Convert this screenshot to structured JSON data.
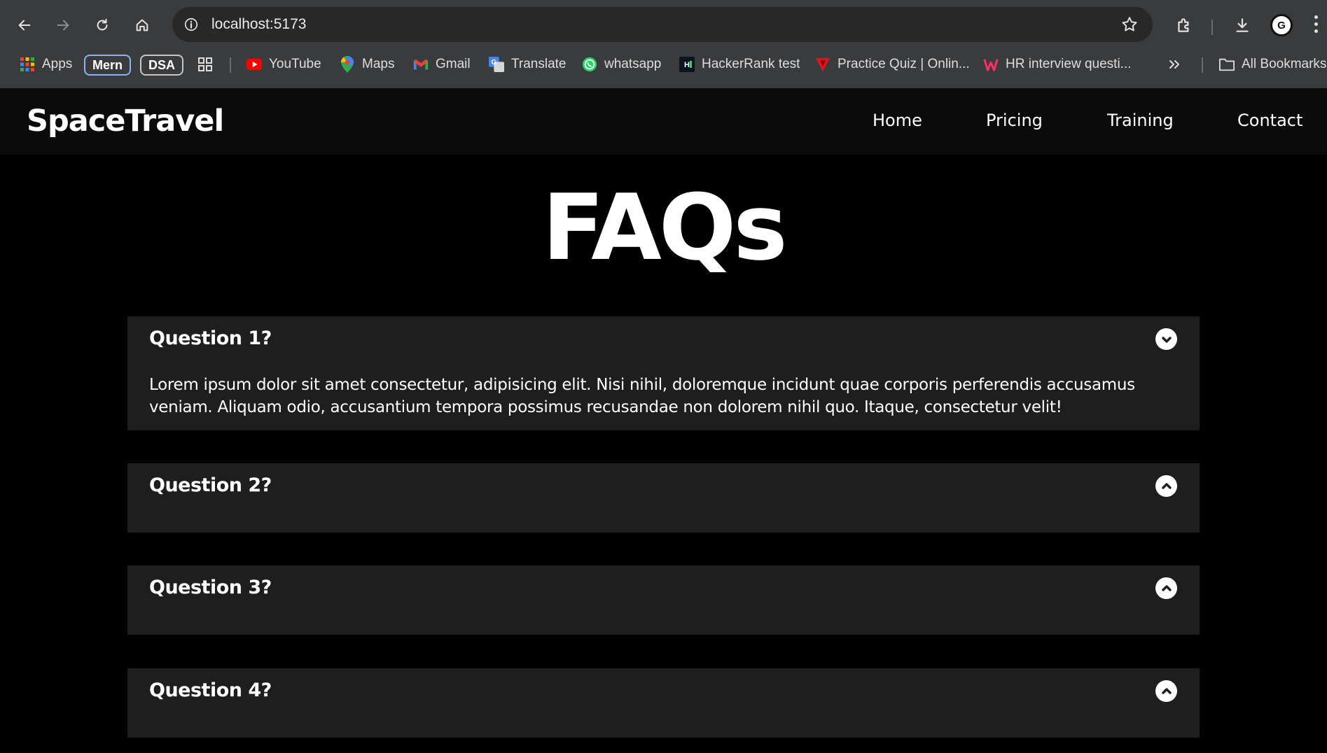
{
  "browser": {
    "url": "localhost:5173",
    "bookmarks": {
      "apps": "Apps",
      "mern": "Mern",
      "dsa": "DSA",
      "youtube": "YouTube",
      "maps": "Maps",
      "gmail": "Gmail",
      "translate": "Translate",
      "whatsapp": "whatsapp",
      "hackerrank": "HackerRank test",
      "practice_quiz": "Practice Quiz | Onlin...",
      "hr_interview": "HR interview questi...",
      "all_bookmarks": "All Bookmarks"
    },
    "profile_initials": "G"
  },
  "app": {
    "brand": "SpaceTravel",
    "nav": {
      "home": "Home",
      "pricing": "Pricing",
      "training": "Training",
      "contact": "Contact"
    }
  },
  "faq": {
    "title": "FAQs",
    "items": [
      {
        "question": "Question 1?",
        "answer": "Lorem ipsum dolor sit amet consectetur, adipisicing elit. Nisi nihil, doloremque incidunt quae corporis perferendis accusamus veniam. Aliquam odio, accusantium tempora possimus recusandae non dolorem nihil quo. Itaque, consectetur velit!",
        "expanded": true
      },
      {
        "question": "Question 2?",
        "expanded": false
      },
      {
        "question": "Question 3?",
        "expanded": false
      },
      {
        "question": "Question 4?",
        "expanded": false
      }
    ]
  },
  "colors": {
    "background": "#000000",
    "nav_background": "#0b0b0b",
    "card_background": "#1f1e1e",
    "text": "#ffffff"
  }
}
